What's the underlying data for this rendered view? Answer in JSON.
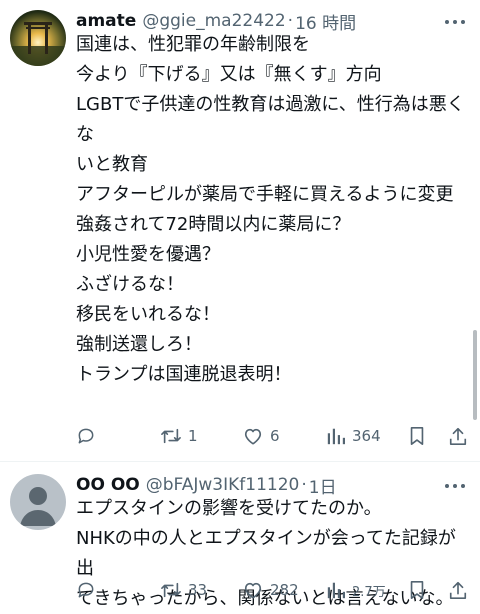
{
  "post1": {
    "display_name": "amate",
    "handle": "@ggie_ma22422",
    "dot": "·",
    "time": "16 時間",
    "lines": [
      "国連は、性犯罪の年齢制限を",
      "今より『下げる』又は『無くす』方向",
      "",
      "LGBTで子供達の性教育は過激に、性行為は悪くな",
      "いと教育",
      "",
      "アフターピルが薬局で手軽に買えるように変更",
      "",
      "強姦されて72時間以内に薬局に？",
      "小児性愛を優遇？",
      "",
      "ふざけるな！",
      "移民をいれるな！",
      "強制送還しろ！",
      "",
      "トランプは国連脱退表明！"
    ],
    "reply_count": "",
    "retweet_count": "1",
    "like_count": "6",
    "view_count": "364"
  },
  "post2": {
    "display_name": "OO OO",
    "handle": "@bFAJw3IKf11120",
    "dot": "·",
    "time": "1日",
    "lines": [
      "エプスタインの影響を受けてたのか。",
      "NHKの中の人とエプスタインが会ってた記録が出",
      "てきちゃったから、関係ないとは言えないな。"
    ],
    "reply_count": "",
    "retweet_count": "33",
    "like_count": "282",
    "view_count": "2.7万"
  },
  "icons": {
    "more": "more-horizontal-icon",
    "reply": "reply-bubble-icon",
    "retweet": "retweet-icon",
    "like": "heart-icon",
    "views": "bar-chart-icon",
    "bookmark": "bookmark-icon",
    "share": "share-upload-icon"
  },
  "colors": {
    "text": "#0f1419",
    "secondary": "#536471",
    "divider": "#eff3f4",
    "default_avatar": "#b9c1c8"
  }
}
